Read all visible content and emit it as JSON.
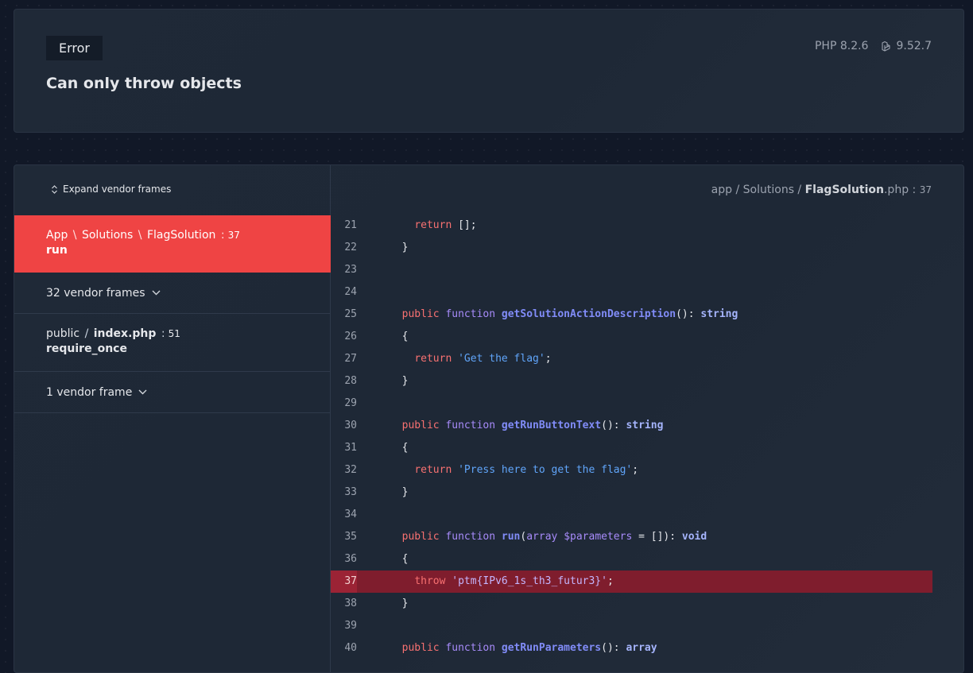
{
  "header": {
    "badge": "Error",
    "message": "Can only throw objects",
    "php_version": "PHP 8.2.6",
    "laravel_version": "9.52.7"
  },
  "sidebar": {
    "expand_label": "Expand vendor frames",
    "frames": [
      {
        "parts": [
          "App",
          "Solutions",
          "FlagSolution"
        ],
        "line": "37",
        "method": "run"
      },
      {
        "vendor_label": "32 vendor frames"
      },
      {
        "path_dir": "public",
        "path_file": "index.php",
        "line": "51",
        "method": "require_once"
      },
      {
        "vendor_label": "1 vendor frame"
      }
    ]
  },
  "code_view": {
    "path_dir1": "app",
    "path_dir2": "Solutions",
    "file_name": "FlagSolution",
    "file_ext": ".php",
    "line": "37",
    "highlighted_line": 37,
    "lines": [
      {
        "n": "21",
        "code": "    return [];"
      },
      {
        "n": "22",
        "code": "  }"
      },
      {
        "n": "23",
        "code": ""
      },
      {
        "n": "24",
        "code": ""
      },
      {
        "n": "25",
        "code": "  public function getSolutionActionDescription(): string"
      },
      {
        "n": "26",
        "code": "  {"
      },
      {
        "n": "27",
        "code": "    return 'Get the flag';"
      },
      {
        "n": "28",
        "code": "  }"
      },
      {
        "n": "29",
        "code": ""
      },
      {
        "n": "30",
        "code": "  public function getRunButtonText(): string"
      },
      {
        "n": "31",
        "code": "  {"
      },
      {
        "n": "32",
        "code": "    return 'Press here to get the flag';"
      },
      {
        "n": "33",
        "code": "  }"
      },
      {
        "n": "34",
        "code": ""
      },
      {
        "n": "35",
        "code": "  public function run(array $parameters = []): void"
      },
      {
        "n": "36",
        "code": "  {"
      },
      {
        "n": "37",
        "code": "    throw 'ptm{IPv6_1s_th3_futur3}';"
      },
      {
        "n": "38",
        "code": "  }"
      },
      {
        "n": "39",
        "code": ""
      },
      {
        "n": "40",
        "code": "  public function getRunParameters(): array"
      }
    ]
  },
  "colors": {
    "accent_red": "#ef4444",
    "highlight_line": "#7f1d2d",
    "background": "#111827"
  },
  "icons": [
    "laravel-icon",
    "expand-arrows-icon",
    "chevron-down-icon"
  ]
}
